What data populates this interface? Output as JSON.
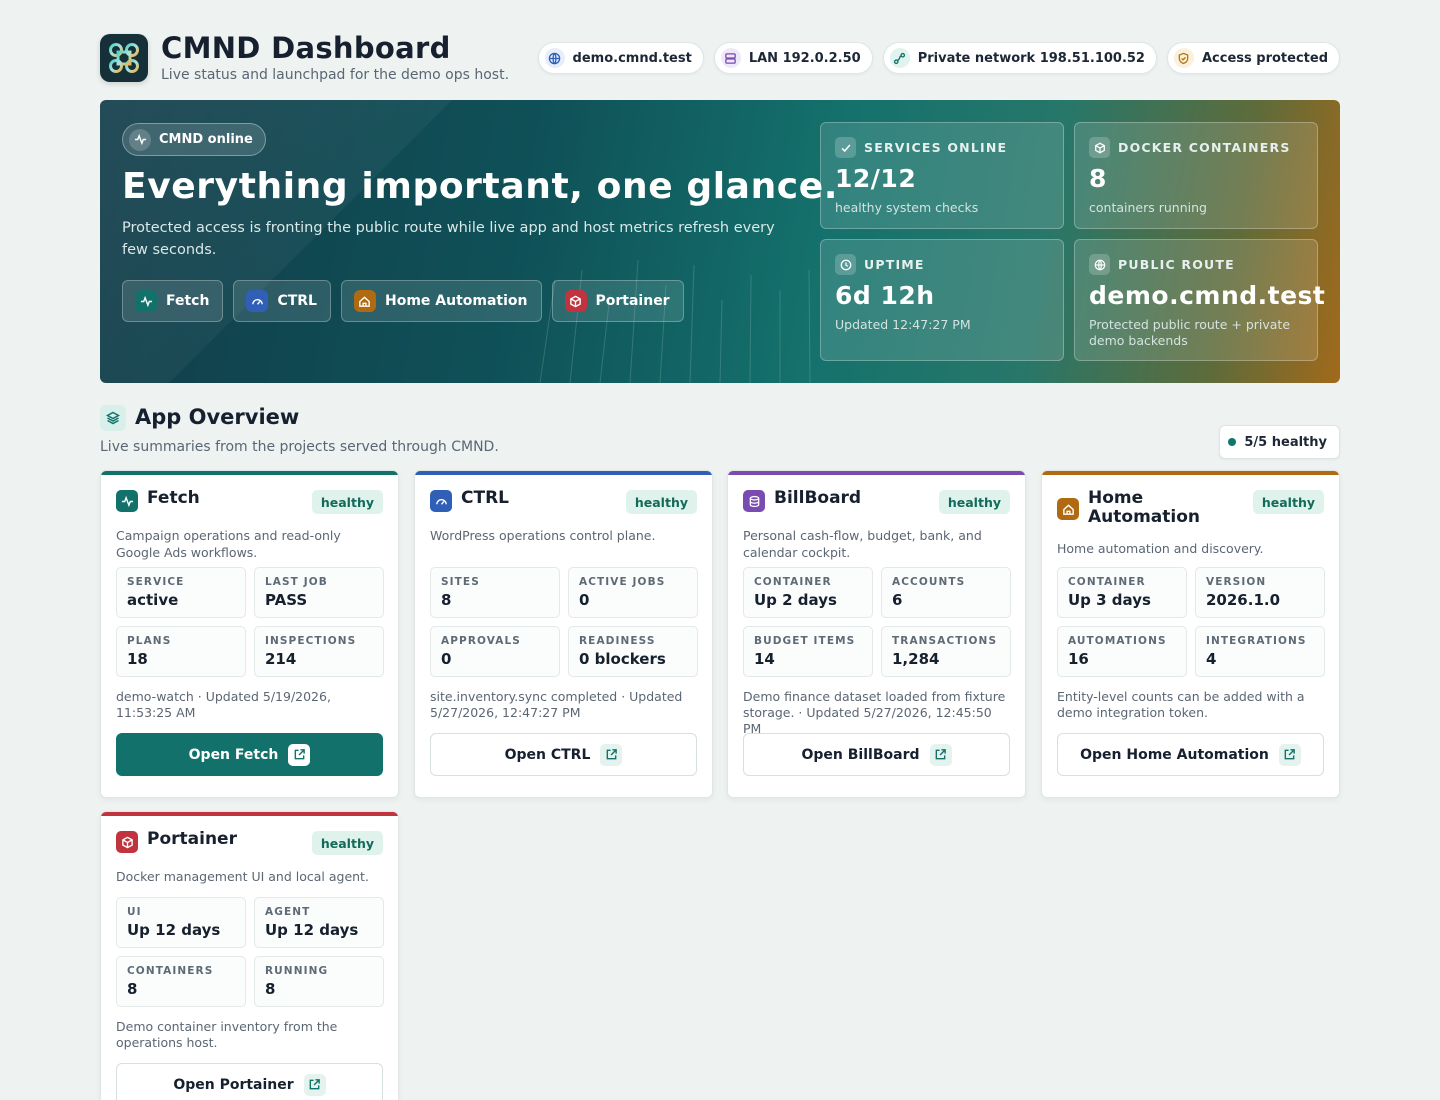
{
  "header": {
    "title": "CMND Dashboard",
    "subtitle": "Live status and launchpad for the demo ops host.",
    "chips": [
      {
        "label": "demo.cmnd.test",
        "icon": "globe-icon",
        "color": "#2f5fb6",
        "bg": "#e6edfb"
      },
      {
        "label": "LAN 192.0.2.50",
        "icon": "server-icon",
        "color": "#7a4bb0",
        "bg": "#efe8f8"
      },
      {
        "label": "Private network 198.51.100.52",
        "icon": "network-icon",
        "color": "#12716a",
        "bg": "#e0f3ee"
      },
      {
        "label": "Access protected",
        "icon": "shield-icon",
        "color": "#b37514",
        "bg": "#fbf0dc"
      }
    ]
  },
  "hero": {
    "badge": "CMND online",
    "title": "Everything important, one glance.",
    "description": "Protected access is fronting the public route while live app and host metrics refresh every few seconds.",
    "buttons": [
      {
        "label": "Fetch",
        "icon": "activity-icon",
        "color": "#12716a"
      },
      {
        "label": "CTRL",
        "icon": "gauge-icon",
        "color": "#2f5fb6"
      },
      {
        "label": "Home Automation",
        "icon": "home-icon",
        "color": "#b06a12"
      },
      {
        "label": "Portainer",
        "icon": "box-icon",
        "color": "#c0343f"
      }
    ],
    "stats": [
      {
        "label": "SERVICES ONLINE",
        "value": "12/12",
        "note": "healthy system checks",
        "icon": "check-icon"
      },
      {
        "label": "DOCKER CONTAINERS",
        "value": "8",
        "note": "containers running",
        "icon": "box-icon"
      },
      {
        "label": "UPTIME",
        "value": "6d 12h",
        "note": "Updated 12:47:27 PM",
        "icon": "clock-icon"
      },
      {
        "label": "PUBLIC ROUTE",
        "value": "demo.cmnd.test",
        "note": "Protected public route + private demo backends",
        "icon": "globe-icon"
      }
    ]
  },
  "overview": {
    "title": "App Overview",
    "subtitle": "Live summaries from the projects served through CMND.",
    "healthy_count": "5/5 healthy"
  },
  "apps": [
    {
      "name": "Fetch",
      "status": "healthy",
      "accent": "#12716a",
      "icon": "activity-icon",
      "description": "Campaign operations and read-only Google Ads workflows.",
      "metrics": [
        {
          "label": "SERVICE",
          "value": "active"
        },
        {
          "label": "LAST JOB",
          "value": "PASS"
        },
        {
          "label": "PLANS",
          "value": "18"
        },
        {
          "label": "INSPECTIONS",
          "value": "214"
        }
      ],
      "footer": "demo-watch · Updated 5/19/2026, 11:53:25 AM",
      "button": "Open Fetch"
    },
    {
      "name": "CTRL",
      "status": "healthy",
      "accent": "#2f5fb6",
      "icon": "gauge-icon",
      "description": "WordPress operations control plane.",
      "metrics": [
        {
          "label": "SITES",
          "value": "8"
        },
        {
          "label": "ACTIVE JOBS",
          "value": "0"
        },
        {
          "label": "APPROVALS",
          "value": "0"
        },
        {
          "label": "READINESS",
          "value": "0 blockers"
        }
      ],
      "footer": "site.inventory.sync completed · Updated 5/27/2026, 12:47:27 PM",
      "button": "Open CTRL"
    },
    {
      "name": "BillBoard",
      "status": "healthy",
      "accent": "#7a4bb0",
      "icon": "database-icon",
      "description": "Personal cash-flow, budget, bank, and calendar cockpit.",
      "metrics": [
        {
          "label": "CONTAINER",
          "value": "Up 2 days"
        },
        {
          "label": "ACCOUNTS",
          "value": "6"
        },
        {
          "label": "BUDGET ITEMS",
          "value": "14"
        },
        {
          "label": "TRANSACTIONS",
          "value": "1,284"
        }
      ],
      "footer": "Demo finance dataset loaded from fixture storage. · Updated 5/27/2026, 12:45:50 PM",
      "button": "Open BillBoard"
    },
    {
      "name": "Home Automation",
      "status": "healthy",
      "accent": "#b06a12",
      "icon": "home-icon",
      "description": "Home automation and discovery.",
      "metrics": [
        {
          "label": "CONTAINER",
          "value": "Up 3 days"
        },
        {
          "label": "VERSION",
          "value": "2026.1.0"
        },
        {
          "label": "AUTOMATIONS",
          "value": "16"
        },
        {
          "label": "INTEGRATIONS",
          "value": "4"
        }
      ],
      "footer": "Entity-level counts can be added with a demo integration token.",
      "button": "Open Home Automation"
    },
    {
      "name": "Portainer",
      "status": "healthy",
      "accent": "#c0343f",
      "icon": "box-icon",
      "description": "Docker management UI and local agent.",
      "metrics": [
        {
          "label": "UI",
          "value": "Up 12 days"
        },
        {
          "label": "AGENT",
          "value": "Up 12 days"
        },
        {
          "label": "CONTAINERS",
          "value": "8"
        },
        {
          "label": "RUNNING",
          "value": "8"
        }
      ],
      "footer": "Demo container inventory from the operations host.",
      "button": "Open Portainer"
    }
  ]
}
